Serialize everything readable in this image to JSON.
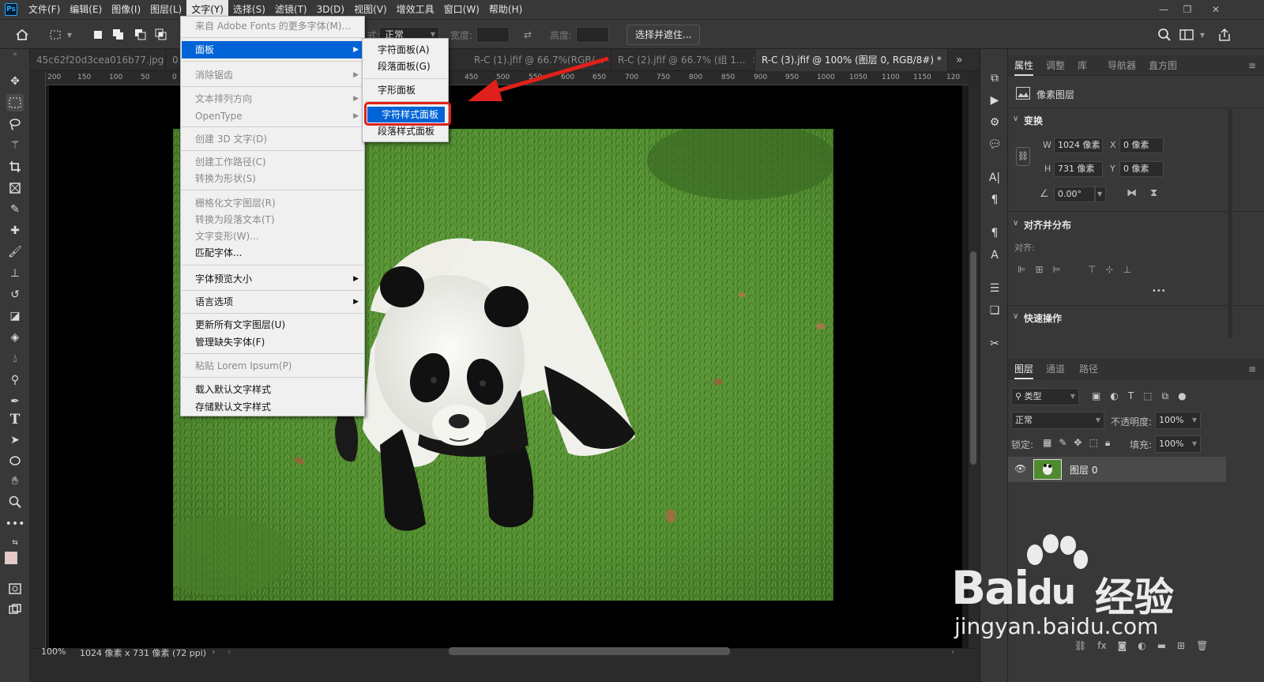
{
  "menubar": {
    "items": [
      "文件(F)",
      "编辑(E)",
      "图像(I)",
      "图层(L)",
      "文字(Y)",
      "选择(S)",
      "滤镜(T)",
      "3D(D)",
      "视图(V)",
      "增效工具",
      "窗口(W)",
      "帮助(H)"
    ],
    "active_index": 4,
    "logo": "Ps"
  },
  "options_bar": {
    "style_label": "式:",
    "style_value": "正常",
    "width_label": "宽度:",
    "height_label": "高度:",
    "select_mask_button": "选择并遮住..."
  },
  "tabs": [
    {
      "label": "45c62f20d3cea016b77.jpg",
      "active": false
    },
    {
      "label": "0",
      "active": false
    },
    {
      "label": "R-C (1).jfif @ 66.7%(RGB/...",
      "active": false
    },
    {
      "label": "R-C (2).jfif @ 66.7% (组 1...",
      "active": false
    },
    {
      "label": "R-C (3).jfif @ 100% (图层 0, RGB/8#) *",
      "active": true
    }
  ],
  "tabs_overflow": "»",
  "ruler_ticks": [
    "200",
    "150",
    "100",
    "50",
    "0",
    "450",
    "500",
    "550",
    "600",
    "650",
    "700",
    "750",
    "800",
    "850",
    "900",
    "950",
    "1000",
    "1050",
    "1100",
    "1150",
    "120"
  ],
  "status": {
    "zoom": "100%",
    "doc_info": "1024 像素 x 731 像素 (72 ppi)"
  },
  "type_menu": {
    "items": [
      {
        "label": "来自 Adobe Fonts 的更多字体(M)...",
        "disabled": true,
        "submenu": false
      },
      {
        "label": "面板",
        "disabled": false,
        "submenu": true,
        "highlight": true
      },
      {
        "label": "消除锯齿",
        "disabled": true,
        "submenu": true
      },
      {
        "label": "文本排列方向",
        "disabled": true,
        "submenu": true
      },
      {
        "label": "OpenType",
        "disabled": true,
        "submenu": true
      },
      {
        "label": "创建 3D 文字(D)",
        "disabled": true,
        "submenu": false
      },
      {
        "label": "创建工作路径(C)",
        "disabled": true,
        "submenu": false
      },
      {
        "label": "转换为形状(S)",
        "disabled": true,
        "submenu": false
      },
      {
        "label": "栅格化文字图层(R)",
        "disabled": true,
        "submenu": false
      },
      {
        "label": "转换为段落文本(T)",
        "disabled": true,
        "submenu": false
      },
      {
        "label": "文字变形(W)...",
        "disabled": true,
        "submenu": false
      },
      {
        "label": "匹配字体...",
        "disabled": false,
        "submenu": false
      },
      {
        "label": "字体预览大小",
        "disabled": false,
        "submenu": true
      },
      {
        "label": "语言选项",
        "disabled": false,
        "submenu": true
      },
      {
        "label": "更新所有文字图层(U)",
        "disabled": false,
        "submenu": false
      },
      {
        "label": "管理缺失字体(F)",
        "disabled": false,
        "submenu": false
      },
      {
        "label": "粘贴 Lorem Ipsum(P)",
        "disabled": true,
        "submenu": false
      },
      {
        "label": "载入默认文字样式",
        "disabled": false,
        "submenu": false
      },
      {
        "label": "存储默认文字样式",
        "disabled": false,
        "submenu": false
      }
    ]
  },
  "panel_submenu": {
    "items": [
      {
        "label": "字符面板(A)"
      },
      {
        "label": "段落面板(G)"
      },
      {
        "label": "字形面板"
      },
      {
        "label": "字符样式面板",
        "highlight": true
      },
      {
        "label": "段落样式面板"
      }
    ]
  },
  "properties": {
    "tabs": [
      "属性",
      "调整",
      "库",
      "导航器",
      "直方图"
    ],
    "layer_type": "像素图层",
    "transform_title": "变换",
    "w_label": "W",
    "w_value": "1024 像素",
    "h_label": "H",
    "h_value": "731 像素",
    "x_label": "X",
    "x_value": "0 像素",
    "y_label": "Y",
    "y_value": "0 像素",
    "angle_value": "0.00°",
    "align_title": "对齐并分布",
    "align_label": "对齐:",
    "more": "•••",
    "quick_title": "快速操作"
  },
  "layers": {
    "tabs": [
      "图层",
      "通道",
      "路径"
    ],
    "filter_label": "类型",
    "blend_mode": "正常",
    "opacity_label": "不透明度:",
    "opacity_value": "100%",
    "lock_label": "锁定:",
    "fill_label": "填充:",
    "fill_value": "100%",
    "layer_name": "图层 0"
  },
  "watermark": {
    "brand": "Bai",
    "brand2": "du",
    "cn": "经验",
    "url": "jingyan.baidu.com"
  },
  "colors": {
    "accent": "#0063d6",
    "highlight_box": "#e0201a",
    "arrow": "#e0201a"
  }
}
